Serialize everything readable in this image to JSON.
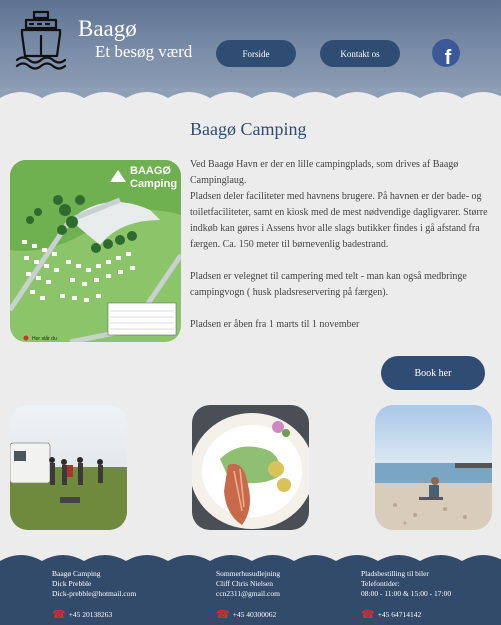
{
  "header": {
    "title": "Baagø",
    "subtitle": "Et besøg værd",
    "nav": [
      "Forside",
      "Kontakt os"
    ],
    "facebook_icon": "f"
  },
  "main": {
    "title": "Baagø Camping",
    "paragraphs": [
      "Ved Baagø Havn er der en lille campingplads, som drives af Baagø Campinglaug.",
      "Pladsen deler faciliteter med havnens brugere. På havnen er der bade- og toiletfaciliteter, samt en kiosk med de mest nødvendige dagligvarer. Større indkøb kan gøres i Assens hvor alle slags butikker findes i gå afstand fra færgen. Ca. 150 meter til børnevenlig badestrand.",
      "Pladsen er velegnet til campering med telt -  man kan også medbringe campingvogn ( husk pladsreservering på færgen).",
      "Pladsen er åben fra 1 marts til 1 november"
    ],
    "book_label": "Book her",
    "map_title_1": "BAAGØ",
    "map_title_2": "Camping",
    "map_legend": "Her står du"
  },
  "footer": {
    "columns": [
      {
        "lines": [
          "Baagø Camping",
          "Dick Prebble",
          "Dick-prebble@hotmail.com"
        ],
        "phone": "+45 20138263"
      },
      {
        "lines": [
          "Sommerhusudlejning",
          "Cliff Chris Nielsen",
          "ccn2311@gmail.com"
        ],
        "phone": "+45 40300062"
      },
      {
        "lines": [
          "Pladsbestilling til biler",
          "Telefontider:",
          "08:00 - 11:00 & 15:00 - 17:00"
        ],
        "phone": "+45 64714142"
      }
    ]
  },
  "colors": {
    "header": "#6f83a0",
    "accent": "#2f4d72",
    "footer": "#324b6a",
    "background": "#ececec"
  }
}
